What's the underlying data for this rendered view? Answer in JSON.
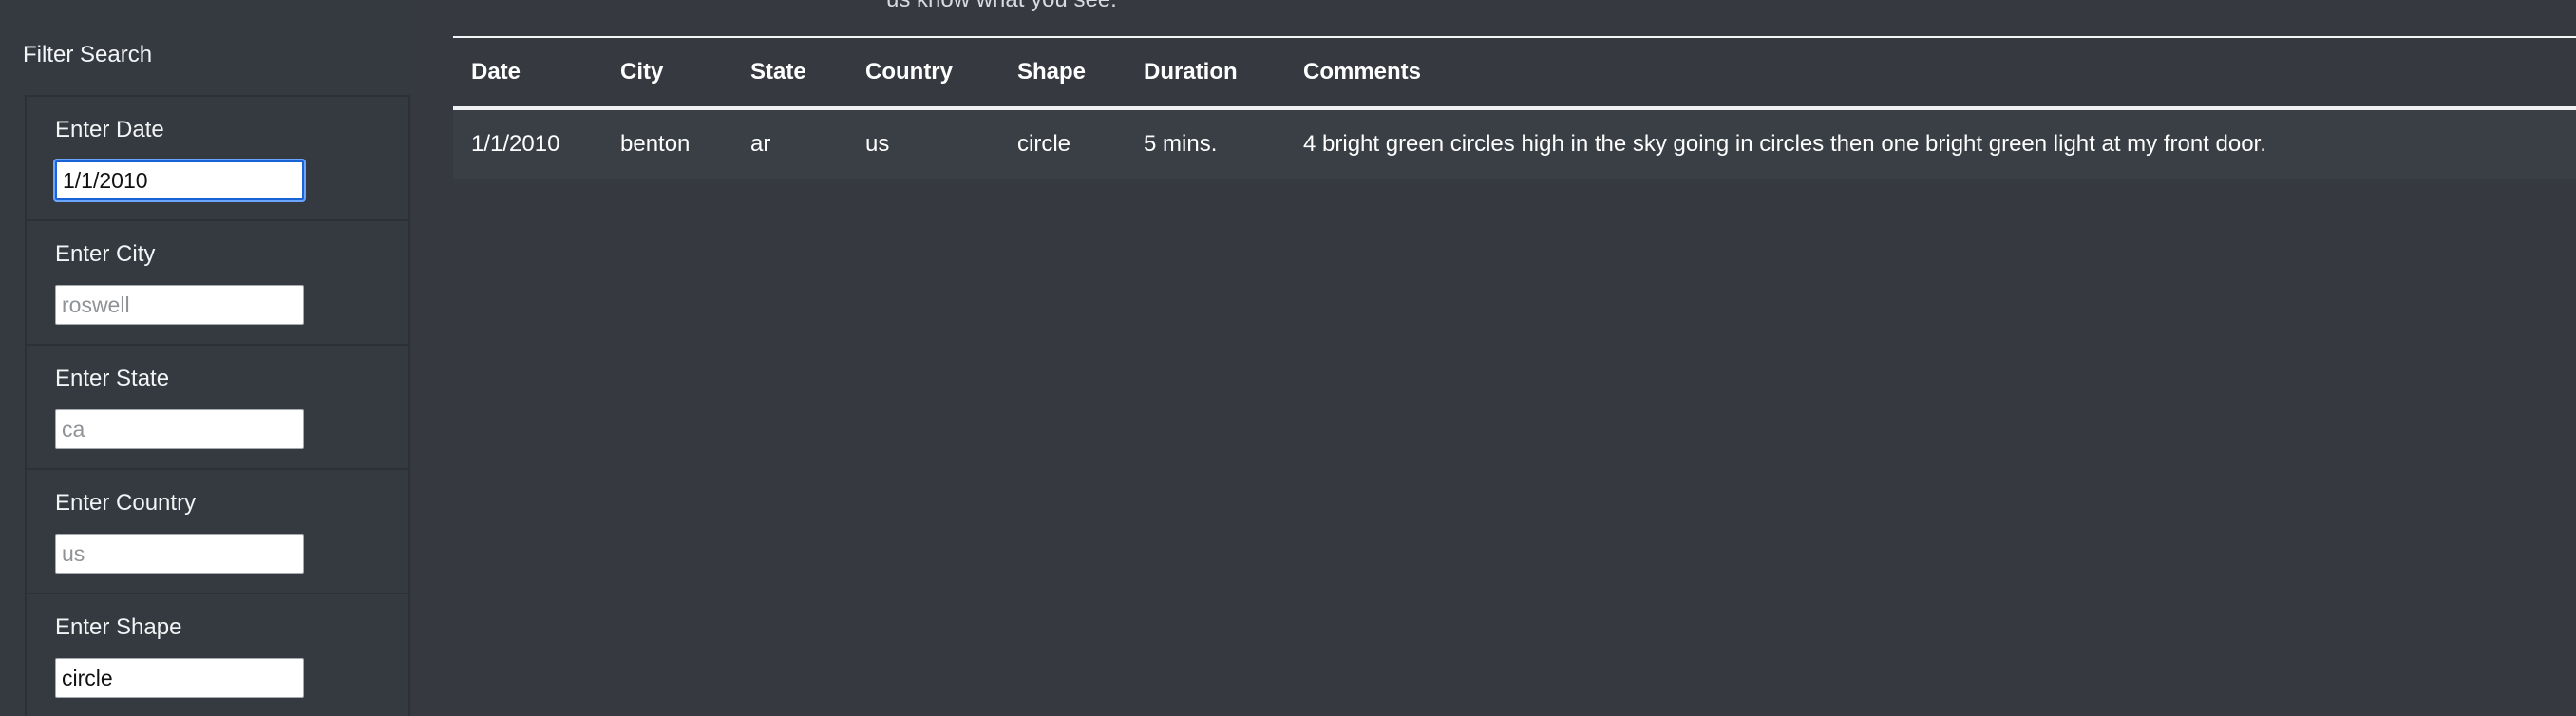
{
  "header": {
    "snippet": "us know what you see."
  },
  "sidebar": {
    "title": "Filter Search",
    "filters": [
      {
        "label": "Enter Date",
        "value": "1/1/2010",
        "placeholder": ""
      },
      {
        "label": "Enter City",
        "value": "",
        "placeholder": "roswell"
      },
      {
        "label": "Enter State",
        "value": "",
        "placeholder": "ca"
      },
      {
        "label": "Enter Country",
        "value": "",
        "placeholder": "us"
      },
      {
        "label": "Enter Shape",
        "value": "circle",
        "placeholder": ""
      }
    ]
  },
  "table": {
    "headers": [
      "Date",
      "City",
      "State",
      "Country",
      "Shape",
      "Duration",
      "Comments"
    ],
    "rows": [
      [
        "1/1/2010",
        "benton",
        "ar",
        "us",
        "circle",
        "5 mins.",
        "4 bright green circles high in the sky going in circles then one bright green light at my front door."
      ]
    ]
  }
}
